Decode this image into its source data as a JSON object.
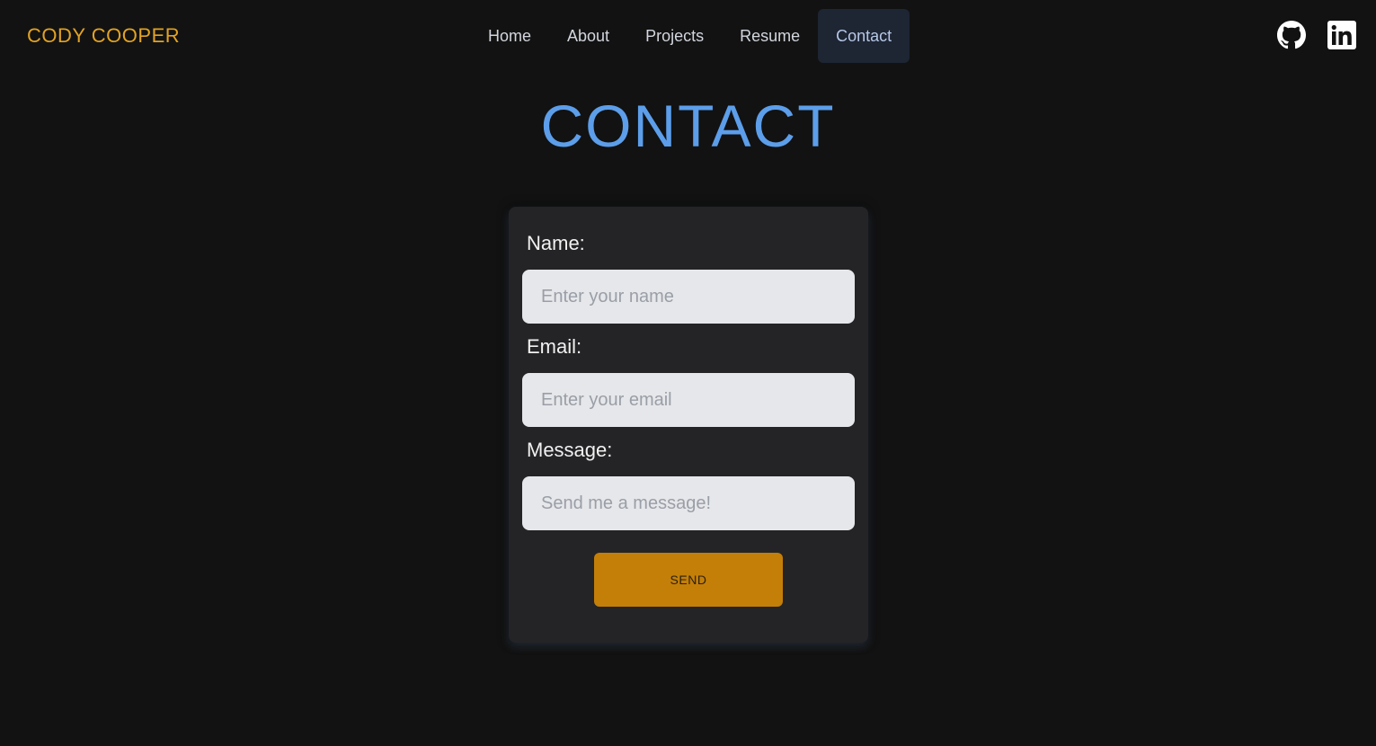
{
  "header": {
    "brand": "CODY COOPER",
    "nav": [
      {
        "label": "Home"
      },
      {
        "label": "About"
      },
      {
        "label": "Projects"
      },
      {
        "label": "Resume"
      },
      {
        "label": "Contact",
        "active": true
      }
    ],
    "social": [
      {
        "icon": "github-icon"
      },
      {
        "icon": "linkedin-icon"
      }
    ]
  },
  "main": {
    "title": "CONTACT",
    "form": {
      "name_label": "Name:",
      "name_placeholder": "Enter your name",
      "email_label": "Email:",
      "email_placeholder": "Enter your email",
      "message_label": "Message:",
      "message_placeholder": "Send me a message!",
      "send_label": "SEND"
    }
  },
  "colors": {
    "background": "#121212",
    "brand": "#e2a324",
    "title": "#5c9eea",
    "card": "#242426",
    "button": "#c47f08",
    "nav_active_bg": "#1e2533"
  }
}
